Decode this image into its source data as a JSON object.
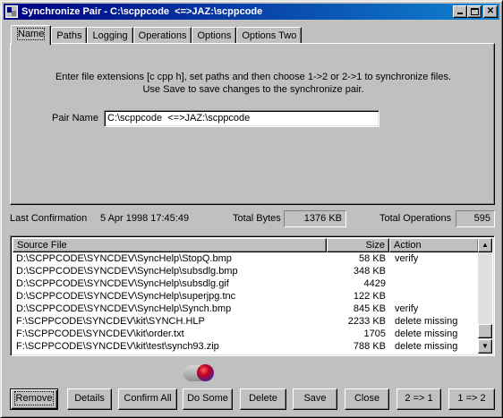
{
  "window": {
    "title": "Synchronize Pair - C:\\scppcode  <=>JAZ:\\scppcode"
  },
  "tabs": [
    {
      "label": "Name",
      "active": true
    },
    {
      "label": "Paths"
    },
    {
      "label": "Logging"
    },
    {
      "label": "Operations"
    },
    {
      "label": "Options"
    },
    {
      "label": "Options Two"
    }
  ],
  "name_tab": {
    "instruction_line1": "Enter file extensions [c cpp h], set paths and then choose 1->2 or 2->1 to synchronize files.",
    "instruction_line2": "Use Save to save changes to the synchronize pair.",
    "pair_name_label": "Pair Name",
    "pair_name_value": "C:\\scppcode  <=>JAZ:\\scppcode"
  },
  "status": {
    "last_confirmation_label": "Last Confirmation",
    "last_confirmation_value": "5 Apr 1998 17:45:49",
    "total_bytes_label": "Total Bytes",
    "total_bytes_value": "1376 KB",
    "total_operations_label": "Total Operations",
    "total_operations_value": "595"
  },
  "list": {
    "columns": {
      "source": "Source File",
      "size": "Size",
      "action": "Action"
    },
    "rows": [
      {
        "source": "D:\\SCPPCODE\\SYNCDEV\\SyncHelp\\StopQ.bmp",
        "size": "58 KB",
        "action": "verify"
      },
      {
        "source": "D:\\SCPPCODE\\SYNCDEV\\SyncHelp\\subsdlg.bmp",
        "size": "348 KB",
        "action": ""
      },
      {
        "source": "D:\\SCPPCODE\\SYNCDEV\\SyncHelp\\subsdlg.gif",
        "size": "4429",
        "action": ""
      },
      {
        "source": "D:\\SCPPCODE\\SYNCDEV\\SyncHelp\\superjpg.tnc",
        "size": "122 KB",
        "action": ""
      },
      {
        "source": "D:\\SCPPCODE\\SYNCDEV\\SyncHelp\\Synch.bmp",
        "size": "845 KB",
        "action": "verify"
      },
      {
        "source": "F:\\SCPPCODE\\SYNCDEV\\kit\\SYNCH.HLP",
        "size": "2233 KB",
        "action": "delete missing"
      },
      {
        "source": "F:\\SCPPCODE\\SYNCDEV\\kit\\order.txt",
        "size": "1705",
        "action": "delete missing"
      },
      {
        "source": "F:\\SCPPCODE\\SYNCDEV\\kit\\test\\synch93.zip",
        "size": "788 KB",
        "action": "delete missing"
      }
    ]
  },
  "buttons": {
    "remove": "Remove",
    "details": "Details",
    "confirm_all": "Confirm All",
    "do_some": "Do Some",
    "delete": "Delete",
    "save": "Save",
    "close": "Close",
    "two_to_one": "2 => 1",
    "one_to_two": "1 => 2"
  }
}
